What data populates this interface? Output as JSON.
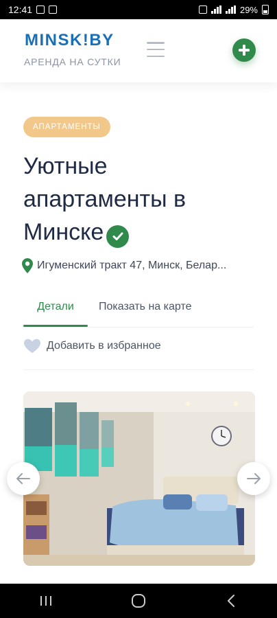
{
  "status_bar": {
    "time": "12:41",
    "battery_percent": "29%"
  },
  "header": {
    "logo": "MINSK!BY",
    "tagline": "АРЕНДА НА СУТКИ"
  },
  "listing": {
    "badge": "АПАРТАМЕНТЫ",
    "title": "Уютные апартаменты в Минске",
    "address": "Игуменский тракт 47, Минск, Белар..."
  },
  "tabs": [
    {
      "label": "Детали",
      "active": true
    },
    {
      "label": "Показать на карте",
      "active": false
    }
  ],
  "favorite": {
    "label": "Добавить в избранное"
  },
  "icons": {
    "menu": "hamburger-icon",
    "add": "plus-icon",
    "verified": "checkmark-icon",
    "location": "map-pin-icon",
    "favorite": "heart-icon",
    "prev": "arrow-left-icon",
    "next": "arrow-right-icon"
  },
  "colors": {
    "brand_blue": "#1b6fb5",
    "accent_green": "#2f8a4b",
    "badge_orange": "#f2c88a"
  }
}
